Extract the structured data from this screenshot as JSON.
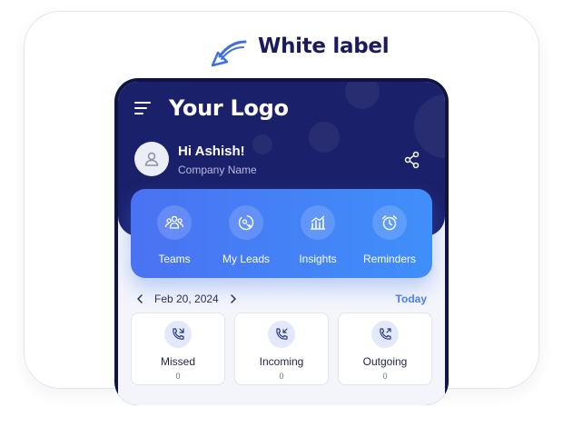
{
  "annotation": {
    "text": "White label"
  },
  "header": {
    "logo_text": "Your Logo",
    "greeting": "Hi Ashish!",
    "company": "Company Name"
  },
  "quick_actions": [
    {
      "label": "Teams",
      "icon": "team-icon"
    },
    {
      "label": "My Leads",
      "icon": "leads-icon"
    },
    {
      "label": "Insights",
      "icon": "insights-icon"
    },
    {
      "label": "Reminders",
      "icon": "alarm-clock-icon"
    }
  ],
  "date_bar": {
    "date": "Feb 20, 2024",
    "today_label": "Today"
  },
  "call_stats": [
    {
      "label": "Missed",
      "count": "0",
      "icon": "missed-call-icon"
    },
    {
      "label": "Incoming",
      "count": "0",
      "icon": "incoming-call-icon"
    },
    {
      "label": "Outgoing",
      "count": "0",
      "icon": "outgoing-call-icon"
    }
  ],
  "colors": {
    "brand_dark": "#1b206a",
    "accent_blue": "#4a7cf2",
    "title_text": "#1a1b5e"
  }
}
